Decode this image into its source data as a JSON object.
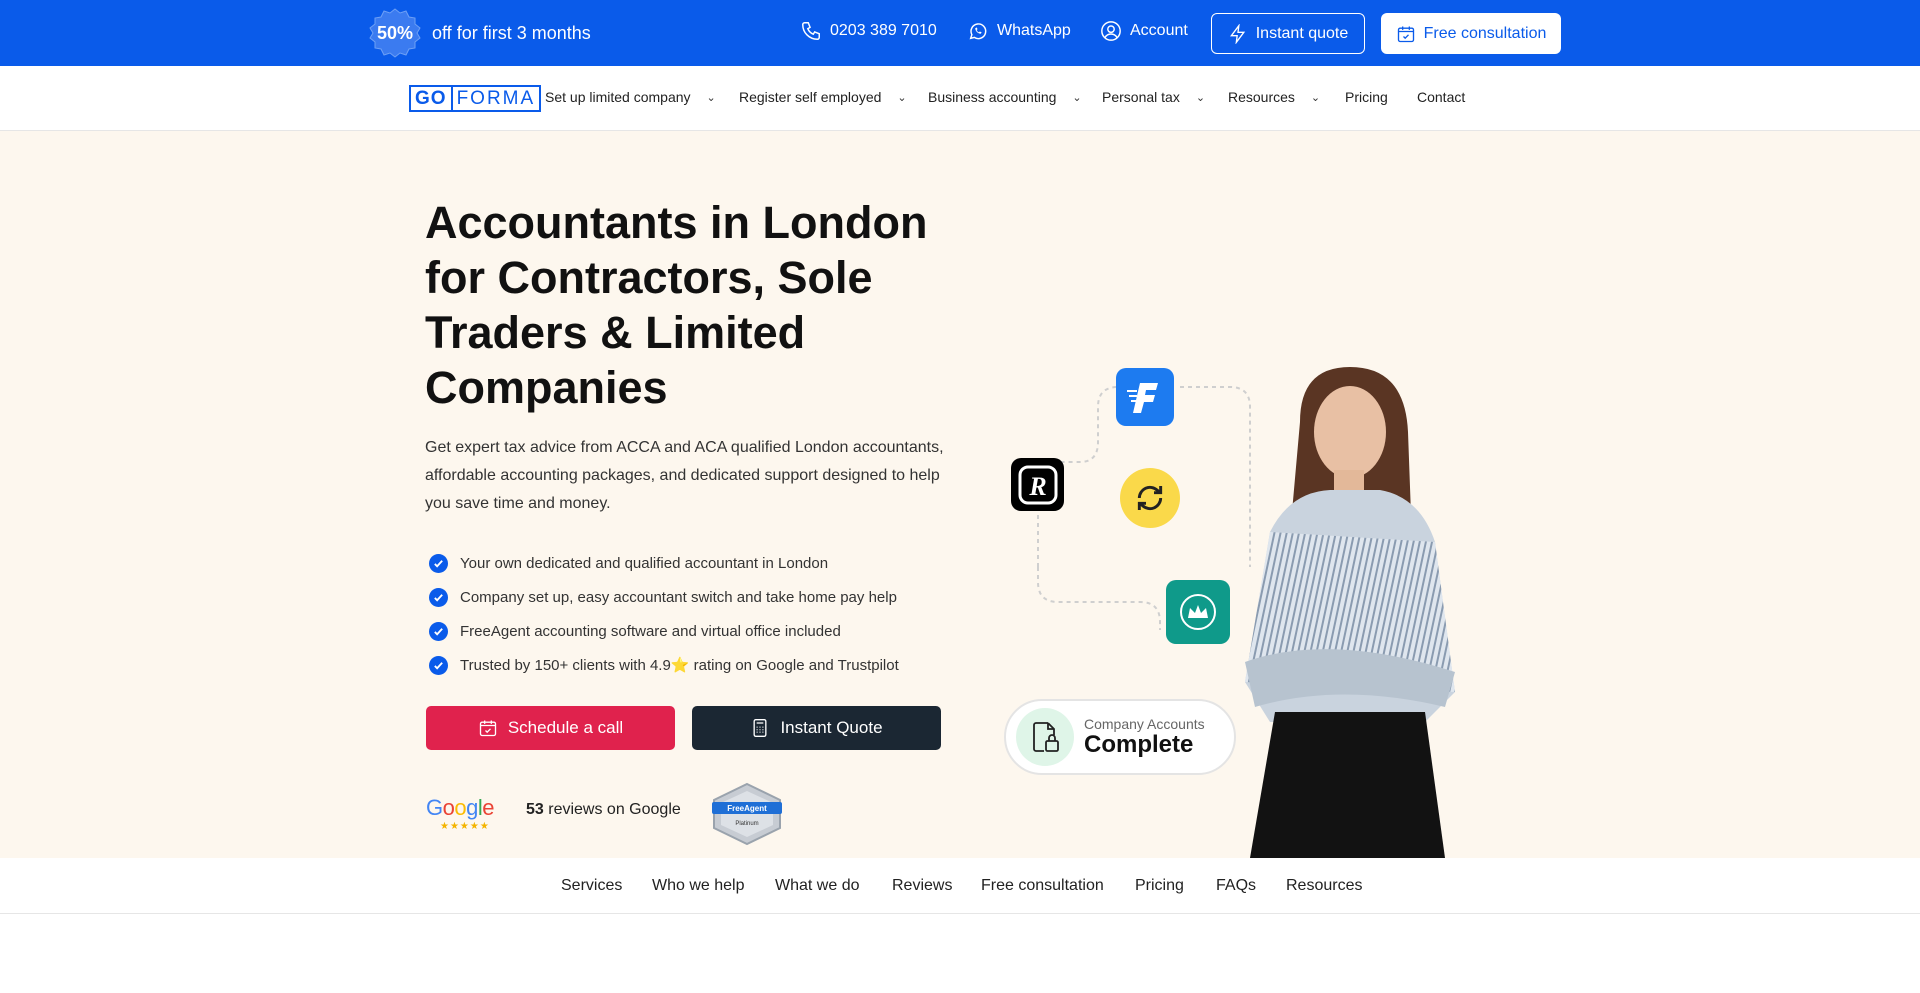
{
  "topbar": {
    "badge": "50%",
    "promo": "off for first 3 months",
    "phone": "0203 389 7010",
    "whatsapp": "WhatsApp",
    "account": "Account",
    "instant_quote": "Instant quote",
    "free_consultation": "Free consultation",
    "colors": {
      "background": "#0a5bea"
    }
  },
  "nav": {
    "logo_left": "GO",
    "logo_right": "FORMA",
    "items": [
      {
        "label": "Set up limited company",
        "dropdown": true
      },
      {
        "label": "Register self employed",
        "dropdown": true
      },
      {
        "label": "Business accounting",
        "dropdown": true
      },
      {
        "label": "Personal tax",
        "dropdown": true
      },
      {
        "label": "Resources",
        "dropdown": true
      },
      {
        "label": "Pricing",
        "dropdown": false
      },
      {
        "label": "Contact",
        "dropdown": false
      }
    ]
  },
  "hero": {
    "title": "Accountants in London for Contractors, Sole Traders & Limited Companies",
    "lead": "Get expert tax advice from ACCA and ACA qualified London accountants, affordable accounting packages, and dedicated support designed to help you save time and money.",
    "checks": [
      "Your own dedicated and qualified accountant in London",
      "Company set up, easy accountant switch and take home pay help",
      "FreeAgent accounting software and virtual office included",
      "Trusted by 150+ clients with 4.9⭐ rating on Google and Trustpilot"
    ],
    "cta_schedule": "Schedule a call",
    "cta_quote": "Instant Quote",
    "google_word": "Google",
    "google_stars": "★★★★★",
    "reviews_count": "53",
    "reviews_text": "reviews on Google",
    "freeagent_badge_top": "FreeAgent",
    "freeagent_badge_bottom": "Platinum",
    "status_label": "Company Accounts",
    "status_value": "Complete",
    "colors": {
      "background": "#fdf7ee",
      "cta_primary": "#e0224d",
      "cta_dark": "#1b2733",
      "check": "#0a5bea"
    }
  },
  "subnav": {
    "items": [
      "Services",
      "Who we help",
      "What we do",
      "Reviews",
      "Free consultation",
      "Pricing",
      "FAQs",
      "Resources"
    ]
  }
}
